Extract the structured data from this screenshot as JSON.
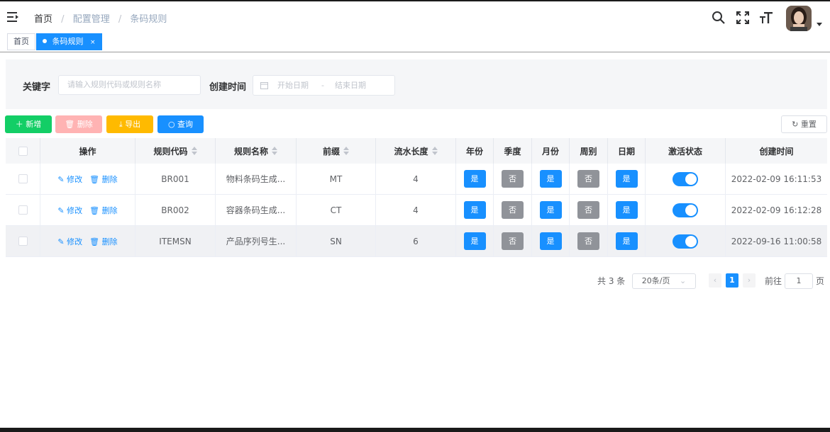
{
  "breadcrumb": [
    "首页",
    "配置管理",
    "条码规则"
  ],
  "tags": {
    "home": "首页",
    "active": "条码规则",
    "close": "×"
  },
  "search": {
    "keyword_label": "关键字",
    "keyword_placeholder": "请输入规则代码或规则名称",
    "created_label": "创建时间",
    "start_placeholder": "开始日期",
    "range_sep": "-",
    "end_placeholder": "结束日期"
  },
  "toolbar": {
    "add": "新增",
    "delete": "删除",
    "export": "导出",
    "query": "查询",
    "reset": "重置"
  },
  "table": {
    "headers": [
      "操作",
      "规则代码",
      "规则名称",
      "前缀",
      "流水长度",
      "年份",
      "季度",
      "月份",
      "周别",
      "日期",
      "激活状态",
      "创建时间"
    ],
    "edit_label": "修改",
    "delete_label": "删除",
    "rows": [
      {
        "code": "BR001",
        "name": "物料条码生成...",
        "prefix": "MT",
        "serial_len": "4",
        "year": "是",
        "quarter": "否",
        "month": "是",
        "week": "否",
        "day": "是",
        "active": true,
        "created": "2022-02-09 16:11:53"
      },
      {
        "code": "BR002",
        "name": "容器条码生成...",
        "prefix": "CT",
        "serial_len": "4",
        "year": "是",
        "quarter": "否",
        "month": "是",
        "week": "否",
        "day": "是",
        "active": true,
        "created": "2022-02-09 16:12:28"
      },
      {
        "code": "ITEMSN",
        "name": "产品序列号生...",
        "prefix": "SN",
        "serial_len": "6",
        "year": "是",
        "quarter": "否",
        "month": "是",
        "week": "否",
        "day": "是",
        "active": true,
        "created": "2022-09-16 11:00:58"
      }
    ]
  },
  "pagination": {
    "total_text": "共 3 条",
    "page_size": "20条/页",
    "current": "1",
    "goto_label": "前往",
    "goto_value": "1",
    "page_unit": "页"
  },
  "colors": {
    "primary": "#1890ff",
    "success": "#13ce66",
    "danger_light": "#ffb3b3",
    "warning": "#ffba00",
    "info": "#909399"
  }
}
